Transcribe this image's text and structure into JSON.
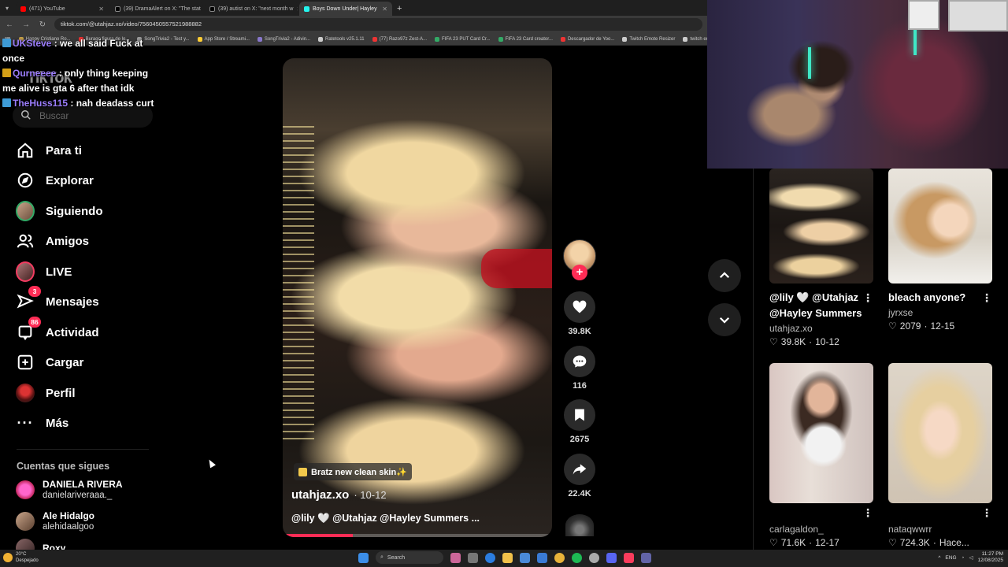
{
  "browser": {
    "tabs": [
      {
        "title": "(471) YouTube",
        "color": "#ff0000",
        "active": false
      },
      {
        "title": "(39) DramaAlert on X: \"The stat",
        "color": "#000000",
        "active": false
      },
      {
        "title": "(39) autist on X: \"next month w",
        "color": "#000000",
        "active": false
      },
      {
        "title": "Boys Down Under| Hayley",
        "color": "#25f4ee",
        "active": true
      }
    ],
    "url": "tiktok.com/@utahjaz.xo/video/7560450557521988882",
    "bookmarks": [
      "Happy Cristiano Ro...",
      "Burago figura de lo...",
      "SongTrivia2 - Test y...",
      "App Store / Streami...",
      "SongTrivia2 - Adivin...",
      "Ratetools v25.1.11",
      "(77) Razo97z Zest-A...",
      "FIFA 23 PUT Card Cr...",
      "FIFA 23 Card creator...",
      "Descargador de Yoo...",
      "Twitch Emote Resizer",
      "twitch em"
    ]
  },
  "chat": [
    {
      "user": "UKSteve",
      "text": " : we all said Fuck at once"
    },
    {
      "user": "Qurneeee",
      "text": " : only thing keeping me alive is gta 6 after that idk"
    },
    {
      "user": "TheHuss115",
      "text": " : nah deadass curt"
    }
  ],
  "sidebar": {
    "logo": "TikTok",
    "search_placeholder": "Buscar",
    "nav": [
      {
        "label": "Para ti",
        "icon": "home-icon"
      },
      {
        "label": "Explorar",
        "icon": "compass-icon"
      },
      {
        "label": "Siguiendo",
        "icon": "following-avatar"
      },
      {
        "label": "Amigos",
        "icon": "friends-icon"
      },
      {
        "label": "LIVE",
        "icon": "live-avatar"
      },
      {
        "label": "Mensajes",
        "icon": "send-icon",
        "badge": "3"
      },
      {
        "label": "Actividad",
        "icon": "inbox-icon",
        "badge": "86"
      },
      {
        "label": "Cargar",
        "icon": "plus-square-icon"
      },
      {
        "label": "Perfil",
        "icon": "profile-avatar"
      },
      {
        "label": "Más",
        "icon": "more-dots-icon"
      }
    ],
    "following_title": "Cuentas que sigues",
    "following": [
      {
        "name": "DANIELA RIVERA",
        "handle": "danielariveraaa._"
      },
      {
        "name": "Ale Hidalgo",
        "handle": "alehidaalgoo"
      },
      {
        "name": "Roxy",
        "handle": ""
      }
    ]
  },
  "video": {
    "tag": "Bratz new clean skin✨",
    "author": "utahjaz.xo",
    "date": "· 10-12",
    "description": "@lily 🤍 @Utahjaz @Hayley Summers ...",
    "progress": 0.26,
    "likes": "39.8K",
    "comments": "116",
    "saves": "2675",
    "shares": "22.4K"
  },
  "related": [
    {
      "title": "@lily 🤍 @Utahjaz @Hayley Summers",
      "user": "utahjaz.xo",
      "likes": "39.8K",
      "date": "10-12"
    },
    {
      "title": "bleach anyone?",
      "user": "jyrxse",
      "likes": "2079",
      "date": "12-15"
    },
    {
      "title": "",
      "user": "carlagaldon_",
      "likes": "71.6K",
      "date": "12-17"
    },
    {
      "title": "",
      "user": "nataqwwrr",
      "likes": "724.3K",
      "date": "Hace..."
    }
  ],
  "taskbar": {
    "weather_temp": "20°C",
    "weather_desc": "Despejado",
    "search": "Search",
    "lang": "ENG",
    "time": "11:27 PM",
    "date": "12/08/2025"
  }
}
